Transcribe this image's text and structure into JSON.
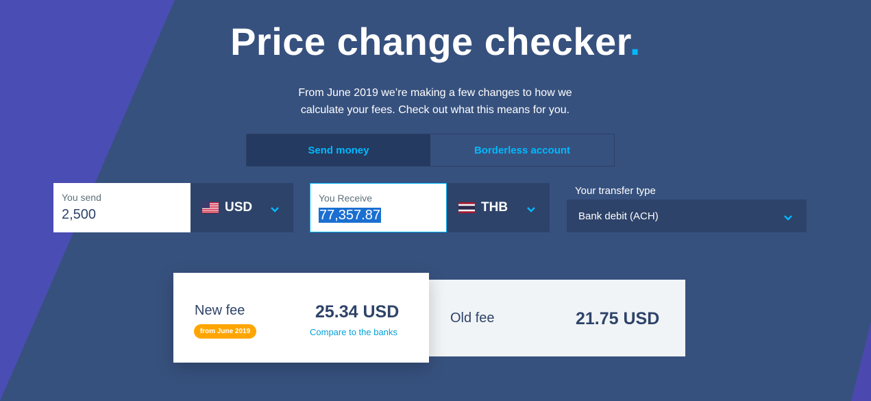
{
  "header": {
    "title": "Price change checker",
    "title_dot": ".",
    "subtitle_line1": "From June 2019 we’re making a few changes to how we",
    "subtitle_line2": "calculate your fees. Check out what this means for you."
  },
  "tabs": [
    {
      "label": "Send money",
      "active": true
    },
    {
      "label": "Borderless account",
      "active": false
    }
  ],
  "send": {
    "label": "You send",
    "value": "2,500",
    "currency": "USD",
    "flag": "us-flag-icon"
  },
  "receive": {
    "label": "You Receive",
    "value": "77,357.87",
    "currency": "THB",
    "flag": "thailand-flag-icon"
  },
  "transfer_type": {
    "label": "Your transfer type",
    "value": "Bank debit (ACH)"
  },
  "new_fee": {
    "label": "New fee",
    "badge": "from June 2019",
    "amount": "25.34 USD",
    "link": "Compare to the banks"
  },
  "old_fee": {
    "label": "Old fee",
    "amount": "21.75 USD"
  },
  "colors": {
    "background": "#37517e",
    "accent": "#00b9ff",
    "badge": "#ffa500",
    "dark_panel": "#2e4369"
  }
}
